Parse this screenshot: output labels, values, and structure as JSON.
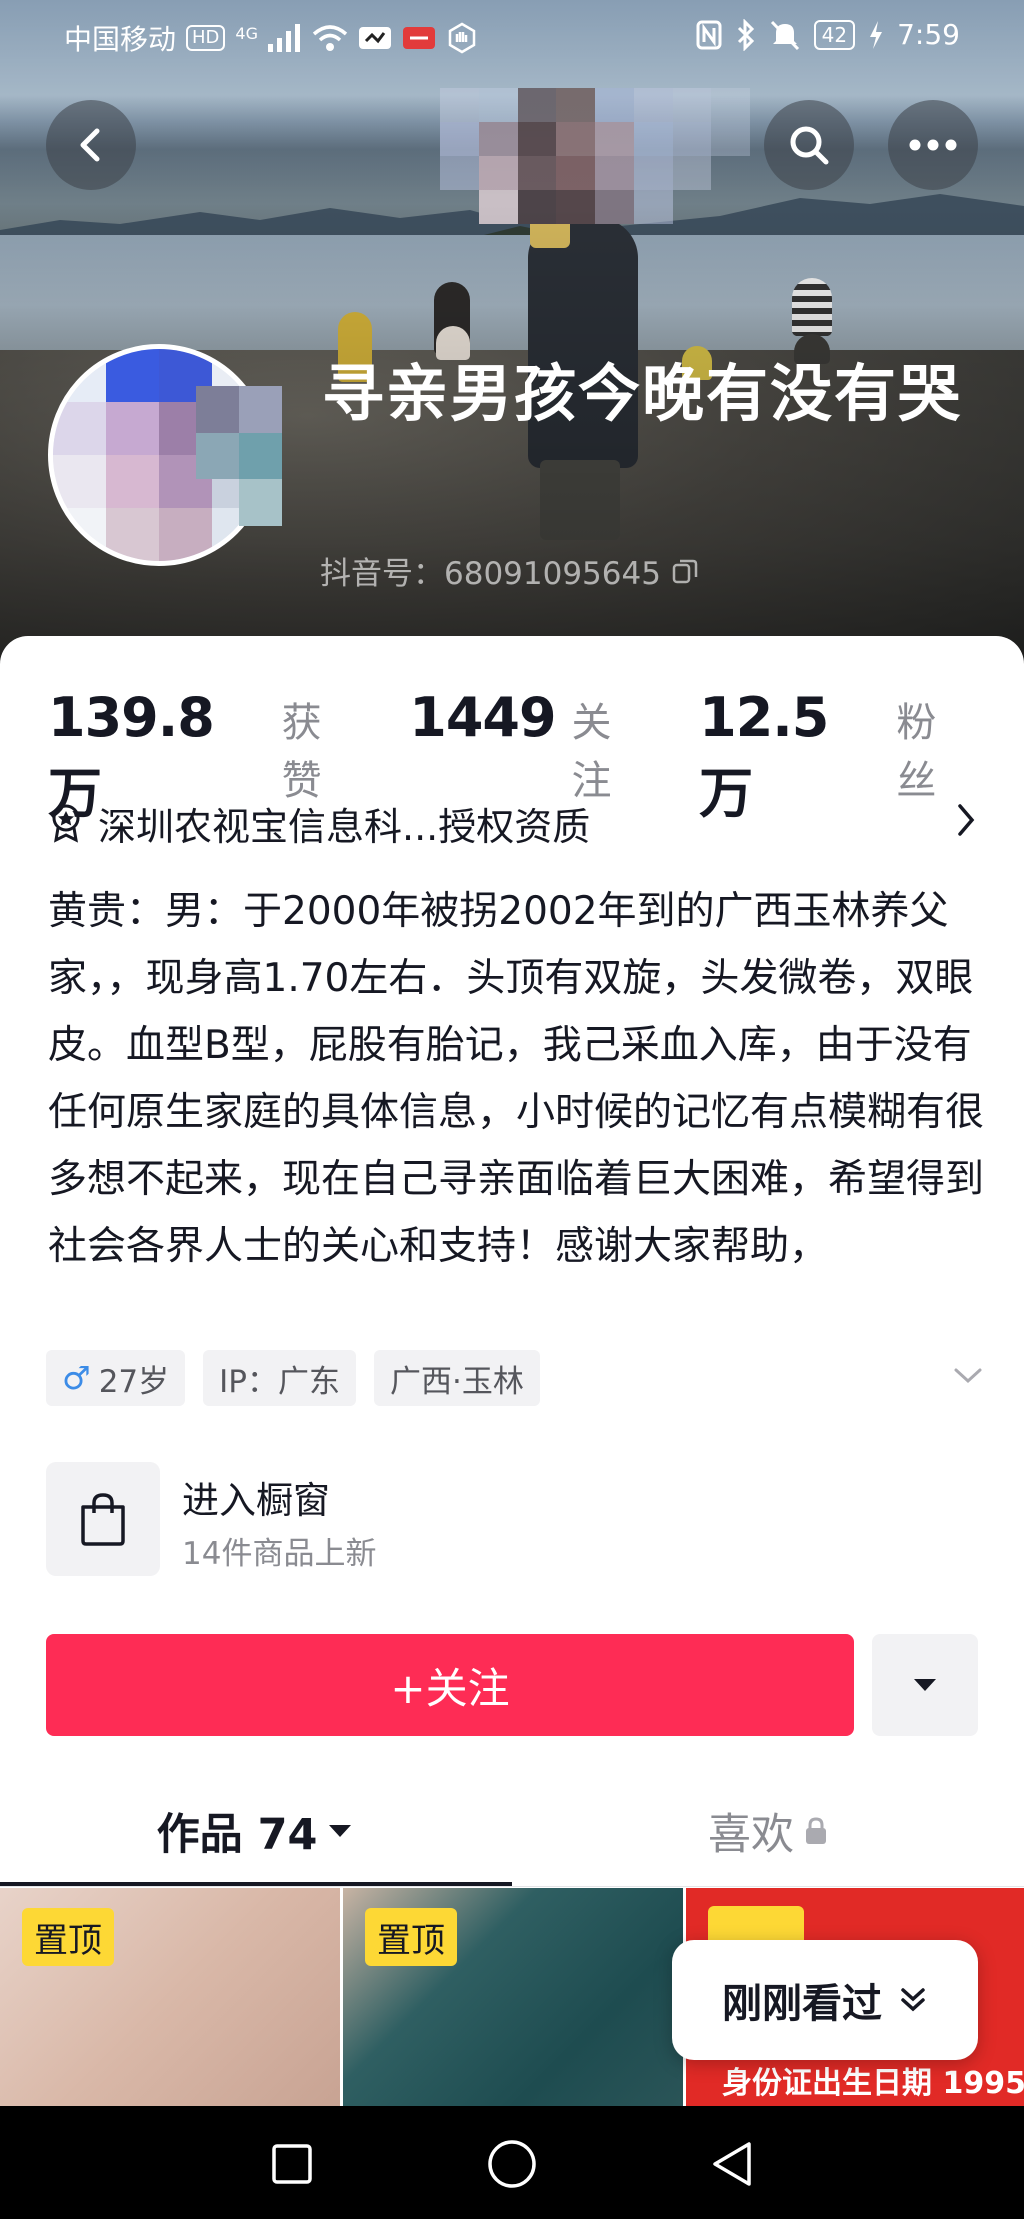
{
  "status_bar": {
    "carrier": "中国移动",
    "hd_badge": "HD",
    "network": "4G",
    "battery": "42",
    "time": "7:59",
    "icons": [
      "signal-icon",
      "wifi-icon",
      "nfc-icon",
      "bluetooth-icon",
      "mute-icon",
      "battery-icon",
      "charging-icon"
    ]
  },
  "header": {
    "back_icon": "back-icon",
    "search_icon": "search-icon",
    "more_icon": "more-icon"
  },
  "profile": {
    "nickname": "寻亲男孩今晚有没有哭",
    "douyin_id": "抖音号：68091095645",
    "copy_icon": "copy-icon"
  },
  "stats": [
    {
      "value": "139.8万",
      "label": "获赞"
    },
    {
      "value": "1449",
      "label": "关注"
    },
    {
      "value": "12.5万",
      "label": "粉丝"
    }
  ],
  "certification": {
    "text": "深圳农视宝信息科...授权资质",
    "icon": "badge-icon"
  },
  "bio": "黄贵：男：于2000年被拐2002年到的广西玉林养父家，，现身高1.70左右．头顶有双旋，头发微卷，双眼皮。血型B型，屁股有胎记，我己采血入库，由于没有任何原生家庭的具体信息，小时候的记忆有点模糊有很多想不起来，现在自己寻亲面临着巨大困难，希望得到社会各界人士的关心和支持！感谢大家帮助，",
  "tags": {
    "gender_symbol": "♂",
    "age": "27岁",
    "ip": "IP：广东",
    "location": "广西·玉林"
  },
  "shop": {
    "title": "进入橱窗",
    "subtitle": "14件商品上新"
  },
  "actions": {
    "follow_label": "+关注"
  },
  "tabs": {
    "works_label": "作品 74",
    "likes_label": "喜欢"
  },
  "videos": [
    {
      "badge": "置顶"
    },
    {
      "badge": "置顶"
    },
    {
      "badge": "",
      "overlay_text": "身份证出生日期 1995"
    }
  ],
  "recently_viewed": {
    "label": "刚刚看过"
  },
  "colors": {
    "accent": "#fe2c55",
    "pin_badge": "#fdd835",
    "text_primary": "#161823",
    "text_secondary": "#8a8b91"
  }
}
